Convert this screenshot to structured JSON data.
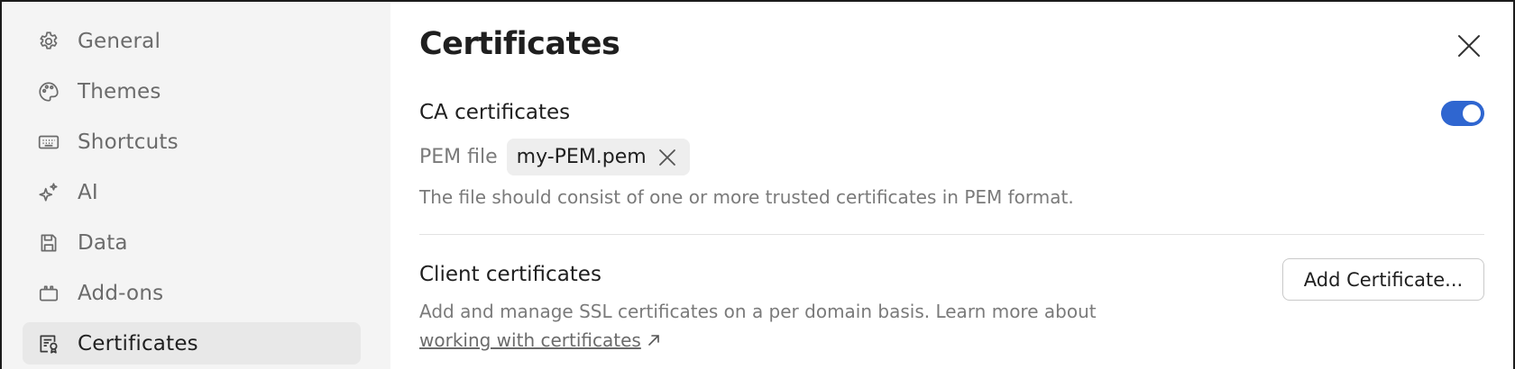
{
  "sidebar": {
    "items": [
      {
        "label": "General",
        "icon": "gear-icon"
      },
      {
        "label": "Themes",
        "icon": "palette-icon"
      },
      {
        "label": "Shortcuts",
        "icon": "keyboard-icon"
      },
      {
        "label": "AI",
        "icon": "sparkles-icon"
      },
      {
        "label": "Data",
        "icon": "save-icon"
      },
      {
        "label": "Add-ons",
        "icon": "plugin-icon"
      },
      {
        "label": "Certificates",
        "icon": "certificate-icon",
        "active": true
      }
    ]
  },
  "main": {
    "title": "Certificates",
    "ca": {
      "title": "CA certificates",
      "toggle_on": true,
      "pem_label": "PEM file",
      "pem_file": "my-PEM.pem",
      "description": "The file should consist of one or more trusted certificates in PEM format."
    },
    "client": {
      "title": "Client certificates",
      "description": "Add and manage SSL certificates on a per domain basis. Learn more about",
      "link_text": "working with certificates",
      "add_button": "Add Certificate..."
    }
  },
  "colors": {
    "accent": "#2f66d0",
    "sidebar_bg": "#f4f4f4",
    "active_item_bg": "#e8e8e8"
  }
}
